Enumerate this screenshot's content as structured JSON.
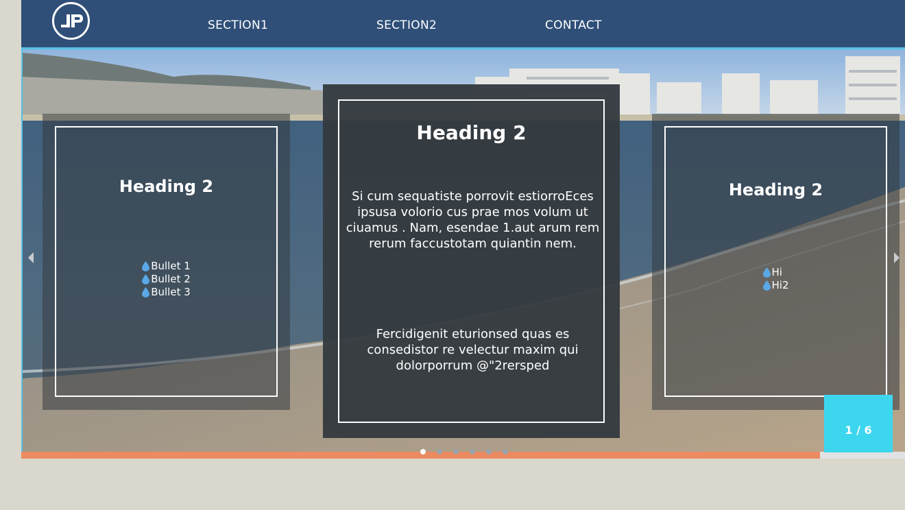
{
  "header": {
    "logo_text": "JP",
    "nav": [
      {
        "label": "SECTION1"
      },
      {
        "label": "SECTION2"
      },
      {
        "label": "CONTACT"
      }
    ]
  },
  "slider": {
    "cards": [
      {
        "heading": "Heading 2",
        "bullets": [
          "Bullet 1",
          "Bullet 2",
          "Bullet 3"
        ]
      },
      {
        "heading": "Heading 2",
        "paragraph1": "Si cum sequatiste porrovit estiorroEces ipsusa volorio cus prae mos volum ut ciuamus . Nam, esendae 1.aut arum rem rerum faccustotam quiantin nem.",
        "paragraph2": "Fercidigenit eturionsed quas es consedistor re velectur maxim qui dolorporrum @\"2rersped"
      },
      {
        "heading": "Heading 2",
        "bullets": [
          "Hi",
          "Hi2"
        ]
      }
    ],
    "counter": "1 / 6",
    "current_slide": 1,
    "total_slides": 6,
    "dots_count": 6,
    "progress_fraction": 0.904,
    "icons": {
      "prev": "chevron-left-icon",
      "next": "chevron-right-icon",
      "bullet": "water-drop-icon"
    }
  },
  "colors": {
    "header": "#2f4f78",
    "accent": "#56c1e3",
    "counter": "#3dd6ef",
    "progress": "#ec8a62",
    "bullet_icon": "#5aa7e6"
  }
}
